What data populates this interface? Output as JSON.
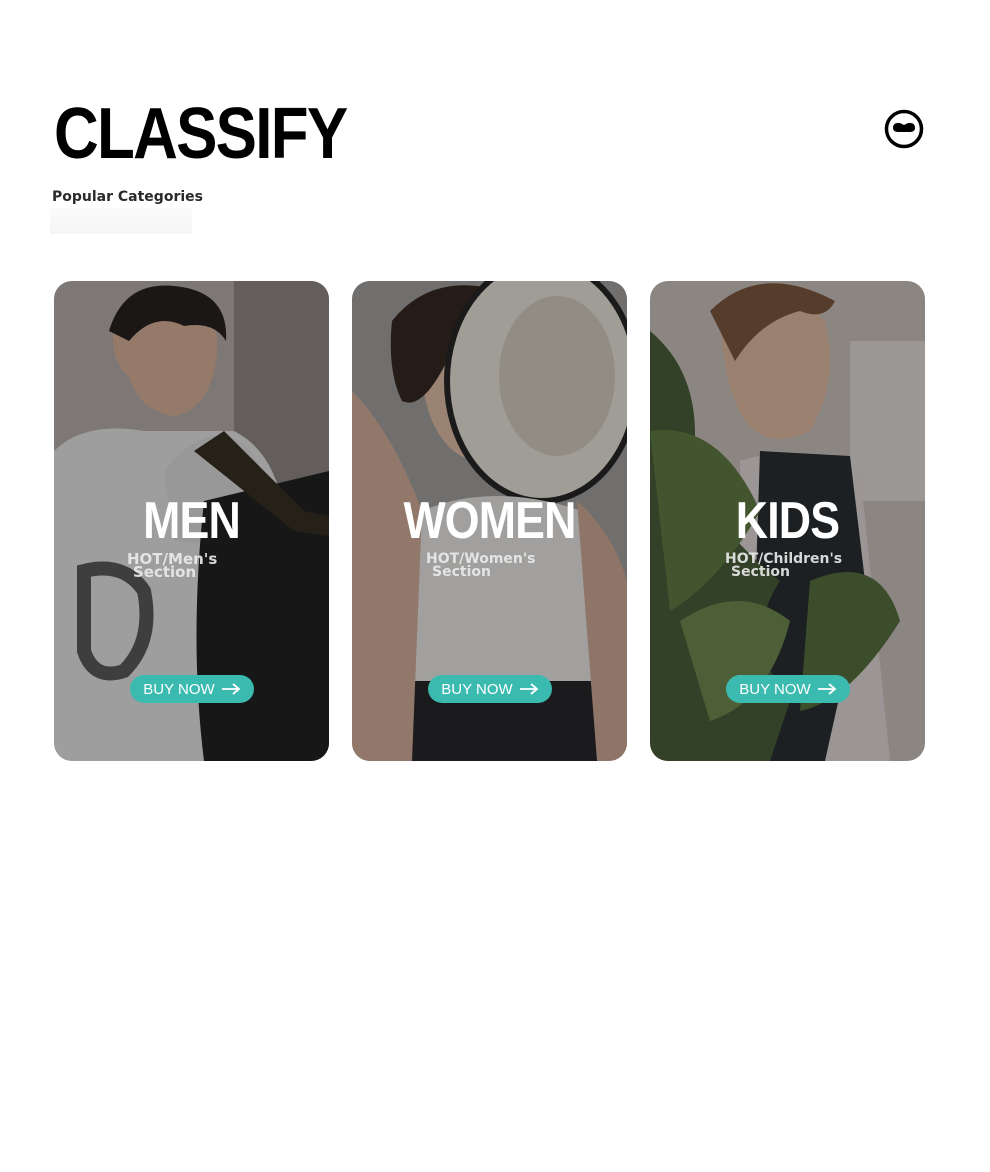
{
  "header": {
    "title": "CLASSIFY",
    "subtitle": "Popular Categories",
    "menu_icon": "menu-toggle-icon"
  },
  "cards": [
    {
      "title": "MEN",
      "sub_line1": "HOT/Men's",
      "sub_line2": "Section",
      "button": "BUY NOW",
      "icon": "arrow-right-icon"
    },
    {
      "title": "WOMEN",
      "sub_line1": "HOT/Women's",
      "sub_line2": "Section",
      "button": "BUY NOW",
      "icon": "arrow-right-icon"
    },
    {
      "title": "KIDS",
      "sub_line1": "HOT/Children's",
      "sub_line2": "Section",
      "button": "BUY NOW",
      "icon": "arrow-right-icon"
    }
  ],
  "colors": {
    "accent": "#3bbab0",
    "title": "#000000",
    "card_text": "#ffffff"
  }
}
